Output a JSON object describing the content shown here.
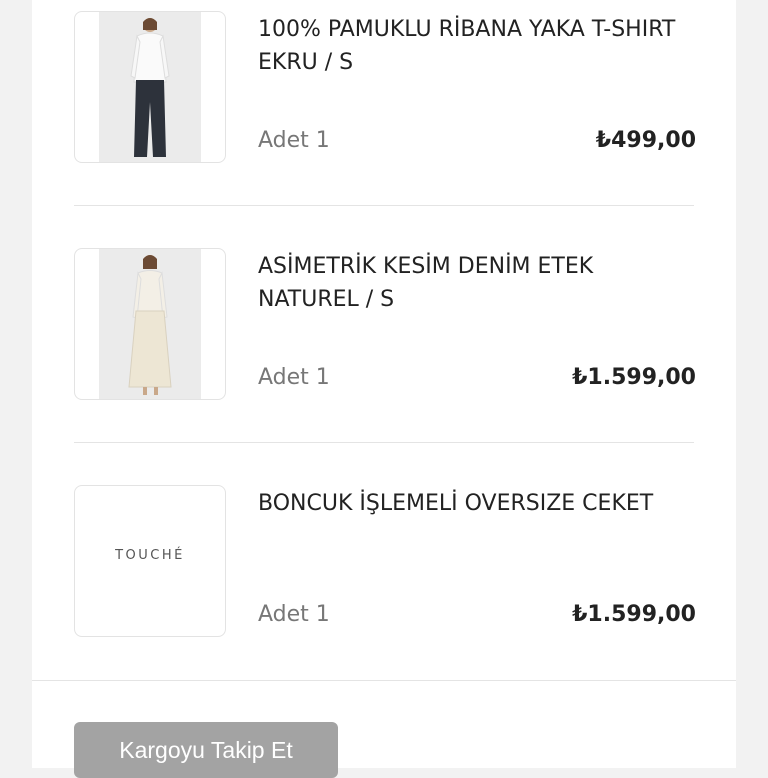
{
  "order_items": [
    {
      "name": "100% PAMUKLU RİBANA YAKA T-SHIRT",
      "variant": "EKRU / S",
      "quantity_label": "Adet 1",
      "price": "₺499,00"
    },
    {
      "name": "ASİMETRİK KESİM DENİM ETEK",
      "variant": "NATUREL / S",
      "quantity_label": "Adet 1",
      "price": "₺1.599,00"
    },
    {
      "name": "BONCUK İŞLEMELİ OVERSIZE CEKET",
      "variant": "",
      "quantity_label": "Adet 1",
      "price": "₺1.599,00",
      "placeholder_brand": "TOUCHÉ"
    }
  ],
  "actions": {
    "track_shipment_label": "Kargoyu Takip Et"
  },
  "colors": {
    "button_bg": "#a3a3a3",
    "price_text": "#222222",
    "quantity_text": "#777777"
  }
}
